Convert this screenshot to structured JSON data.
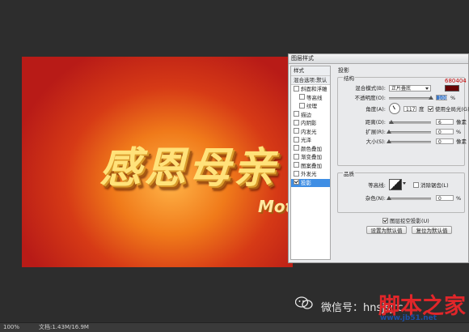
{
  "canvas": {
    "main_text": "感恩母亲",
    "sub_text": "Mother"
  },
  "dialog": {
    "title": "图层样式",
    "styles_header": "样式",
    "blend_default": "混合选项:默认",
    "styles": [
      {
        "label": "斜面和浮雕",
        "checked": false,
        "sub": false
      },
      {
        "label": "等高线",
        "checked": false,
        "sub": true
      },
      {
        "label": "纹理",
        "checked": false,
        "sub": true
      },
      {
        "label": "描边",
        "checked": false,
        "sub": false
      },
      {
        "label": "内阴影",
        "checked": false,
        "sub": false
      },
      {
        "label": "内发光",
        "checked": false,
        "sub": false
      },
      {
        "label": "光泽",
        "checked": false,
        "sub": false
      },
      {
        "label": "颜色叠加",
        "checked": false,
        "sub": false
      },
      {
        "label": "渐变叠加",
        "checked": false,
        "sub": false
      },
      {
        "label": "图案叠加",
        "checked": false,
        "sub": false
      },
      {
        "label": "外发光",
        "checked": false,
        "sub": false
      },
      {
        "label": "投影",
        "checked": true,
        "sub": false,
        "selected": true
      }
    ],
    "section": "投影",
    "structure": {
      "label": "结构",
      "hex": "680404",
      "color": "#680404",
      "blend_mode_label": "混合模式(B):",
      "blend_mode_value": "正片叠底",
      "opacity_label": "不透明度(O):",
      "opacity_value": "100",
      "opacity_unit": "%",
      "angle_label": "角度(A):",
      "angle_value": "117",
      "angle_unit": "度",
      "global_light_label": "使用全局光(G)",
      "distance_label": "距离(D):",
      "distance_value": "6",
      "distance_unit": "像素",
      "spread_label": "扩展(R):",
      "spread_value": "0",
      "spread_unit": "%",
      "size_label": "大小(S):",
      "size_value": "0",
      "size_unit": "像素"
    },
    "quality": {
      "label": "品质",
      "contour_label": "等高线:",
      "antialias_label": "消除锯齿(L)",
      "noise_label": "杂色(N):",
      "noise_value": "0",
      "noise_unit": "%"
    },
    "knockout_label": "图层挖空投影(U)",
    "default_btn": "设置为默认值",
    "reset_btn": "复位为默认值"
  },
  "status": {
    "zoom": "100%",
    "doc": "文档:1.43M/16.9M"
  },
  "watermark": {
    "text": "微信号：hnsjsjtc",
    "site": "脚本之家",
    "url": "www.jb51.net"
  }
}
